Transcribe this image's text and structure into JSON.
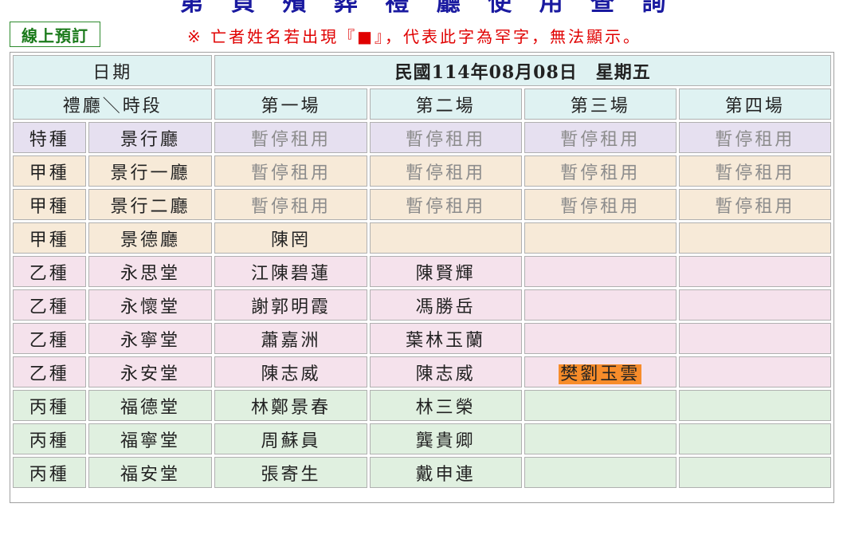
{
  "page": {
    "title_partial": "第  頁 殯 葬 禮 廳 使 用 查 詢",
    "online_booking_label": "線上預訂",
    "notice_text": "※ 亡者姓名若出現『■』，代表此字為罕字，無法顯示。"
  },
  "table": {
    "date_label": "日期",
    "date_value": "民國114年08月08日　星期五",
    "hall_slot_label": "禮廳＼時段",
    "slots": [
      "第一場",
      "第二場",
      "第三場",
      "第四場"
    ],
    "rows": [
      {
        "type": "特種",
        "hall": "景行廳",
        "cells": [
          "暫停租用",
          "暫停租用",
          "暫停租用",
          "暫停租用"
        ]
      },
      {
        "type": "甲種",
        "hall": "景行一廳",
        "cells": [
          "暫停租用",
          "暫停租用",
          "暫停租用",
          "暫停租用"
        ]
      },
      {
        "type": "甲種",
        "hall": "景行二廳",
        "cells": [
          "暫停租用",
          "暫停租用",
          "暫停租用",
          "暫停租用"
        ]
      },
      {
        "type": "甲種",
        "hall": "景德廳",
        "cells": [
          "陳罔",
          "",
          "",
          ""
        ]
      },
      {
        "type": "乙種",
        "hall": "永思堂",
        "cells": [
          "江陳碧蓮",
          "陳賢輝",
          "",
          ""
        ]
      },
      {
        "type": "乙種",
        "hall": "永懷堂",
        "cells": [
          "謝郭明霞",
          "馮勝岳",
          "",
          ""
        ]
      },
      {
        "type": "乙種",
        "hall": "永寧堂",
        "cells": [
          "蕭嘉洲",
          "葉林玉蘭",
          "",
          ""
        ]
      },
      {
        "type": "乙種",
        "hall": "永安堂",
        "cells": [
          "陳志威",
          "陳志威",
          "樊劉玉雲",
          ""
        ]
      },
      {
        "type": "丙種",
        "hall": "福德堂",
        "cells": [
          "林鄭景春",
          "林三榮",
          "",
          ""
        ]
      },
      {
        "type": "丙種",
        "hall": "福寧堂",
        "cells": [
          "周蘇員",
          "龔貴卿",
          "",
          ""
        ]
      },
      {
        "type": "丙種",
        "hall": "福安堂",
        "cells": [
          "張寄生",
          "戴申連",
          "",
          ""
        ]
      }
    ]
  },
  "colors": {
    "header_bg": "#dff2f2",
    "special_bg": "#e6e0f0",
    "jia_bg": "#f7ead8",
    "yi_bg": "#f5e2ec",
    "bing_bg": "#e0f0e0",
    "highlight": "#f78c2a",
    "notice_red": "#e00000"
  }
}
